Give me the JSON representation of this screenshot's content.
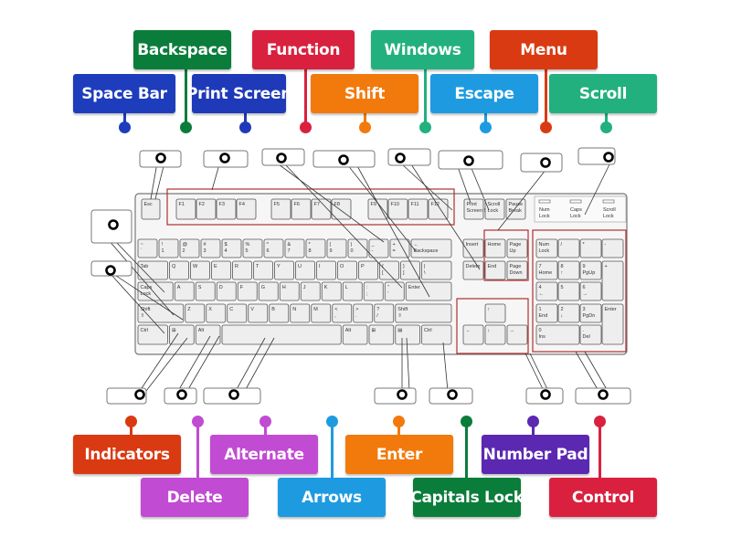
{
  "game": {
    "top_labels": [
      {
        "text": "Backspace",
        "color": "#0b7d3b",
        "pin_color": "#0b7d3b"
      },
      {
        "text": "Function",
        "color": "#d9213f",
        "pin_color": "#d9213f"
      },
      {
        "text": "Windows",
        "color": "#22b07f",
        "pin_color": "#22b07f"
      },
      {
        "text": "Menu",
        "color": "#d93a12",
        "pin_color": "#d93a12"
      },
      {
        "text": "Space Bar",
        "color": "#1e3dbd",
        "pin_color": "#1e3dbd"
      },
      {
        "text": "Print Screen",
        "color": "#1f3ab8",
        "pin_color": "#1f3ab8"
      },
      {
        "text": "Shift",
        "color": "#f27a0c",
        "pin_color": "#f27a0c"
      },
      {
        "text": "Escape",
        "color": "#1e9be0",
        "pin_color": "#1e9be0"
      },
      {
        "text": "Scroll",
        "color": "#22b07f",
        "pin_color": "#22b07f"
      }
    ],
    "bottom_labels": [
      {
        "text": "Indicators",
        "color": "#d93a12"
      },
      {
        "text": "Alternate",
        "color": "#c14bd2"
      },
      {
        "text": "Enter",
        "color": "#f27a0c"
      },
      {
        "text": "Number Pad",
        "color": "#5b28b2"
      },
      {
        "text": "Delete",
        "color": "#c14bd2"
      },
      {
        "text": "Arrows",
        "color": "#1e9be0"
      },
      {
        "text": "Capitals Lock",
        "color": "#0b7d3b"
      },
      {
        "text": "Control",
        "color": "#d9213f"
      }
    ]
  },
  "keyboard": {
    "function_row": [
      "Esc",
      "F1",
      "F2",
      "F3",
      "F4",
      "F5",
      "F6",
      "F7",
      "F8",
      "F9",
      "F10",
      "F11",
      "F12"
    ],
    "system_keys": [
      "Print Screen SysRq",
      "Scroll Lock",
      "Pause Break"
    ],
    "indicators": [
      "Num Lock",
      "Caps Lock",
      "Scroll Lock"
    ],
    "main_rows": [
      [
        "~ `",
        "! 1",
        "@ 2",
        "# 3",
        "$ 4",
        "% 5",
        "^ 6",
        "& 7",
        "* 8",
        "( 9",
        ") 0",
        "_ -",
        "+ =",
        "← Backspace"
      ],
      [
        "Tab",
        "Q",
        "W",
        "E",
        "R",
        "T",
        "Y",
        "U",
        "I",
        "O",
        "P",
        "{ [",
        "} ]",
        "| \\"
      ],
      [
        "Caps Lock",
        "A",
        "S",
        "D",
        "F",
        "G",
        "H",
        "J",
        "K",
        "L",
        ": ;",
        "\" '",
        "Enter"
      ],
      [
        "Shift ⇧",
        "Z",
        "X",
        "C",
        "V",
        "B",
        "N",
        "M",
        "< ,",
        "> .",
        "? /",
        "Shift ⇧"
      ],
      [
        "Ctrl",
        "⊞",
        "Alt",
        "",
        "Alt",
        "⊞",
        "▤",
        "Ctrl"
      ]
    ],
    "nav_keys": [
      "Insert",
      "Home",
      "Page Up",
      "Delete",
      "End",
      "Page Down"
    ],
    "arrow_keys": [
      "↑",
      "←",
      "↓",
      "→"
    ],
    "numpad": [
      "Num Lock",
      "/",
      "*",
      "-",
      "7 Home",
      "8 ↑",
      "9 PgUp",
      "+",
      "4 ←",
      "5",
      "6 →",
      "1 End",
      "2 ↓",
      "3 PgDn",
      "Enter",
      "0 Ins",
      ". Del"
    ]
  }
}
